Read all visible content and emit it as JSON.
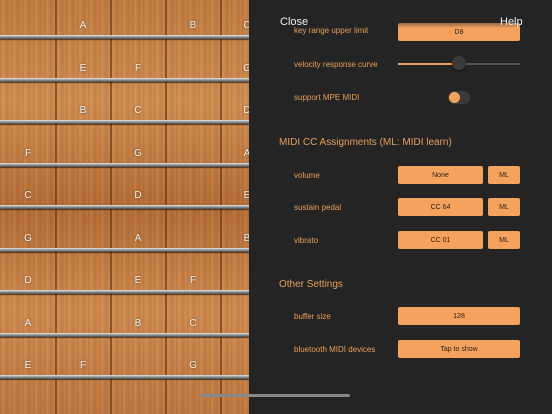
{
  "fretboard": {
    "rows": [
      [
        "",
        "A",
        "",
        "B",
        "C"
      ],
      [
        "",
        "E",
        "F",
        "",
        "G"
      ],
      [
        "",
        "B",
        "C",
        "",
        "D"
      ],
      [
        "F",
        "",
        "G",
        "",
        "A"
      ],
      [
        "C",
        "",
        "D",
        "",
        "E"
      ],
      [
        "G",
        "",
        "A",
        "",
        "B"
      ],
      [
        "D",
        "",
        "E",
        "F",
        ""
      ],
      [
        "A",
        "",
        "B",
        "C",
        ""
      ],
      [
        "E",
        "F",
        "",
        "G",
        ""
      ]
    ]
  },
  "header": {
    "close_label": "Close",
    "help_label": "Help"
  },
  "settings": {
    "key_range_upper_label": "key range upper limit",
    "key_range_upper_value": "D8",
    "velocity_curve_label": "velocity response curve",
    "velocity_curve_level": 0.5,
    "mpe_label": "support MPE MIDI",
    "mpe_enabled": true
  },
  "midi_cc": {
    "title": "MIDI CC Assignments  (ML: MIDI learn)",
    "rows": [
      {
        "label": "volume",
        "value": "None",
        "learn": "ML"
      },
      {
        "label": "sustain pedal",
        "value": "CC 64",
        "learn": "ML"
      },
      {
        "label": "vibrato",
        "value": "CC 01",
        "learn": "ML"
      }
    ]
  },
  "other": {
    "title": "Other Settings",
    "buffer_label": "buffer size",
    "buffer_value": "128",
    "bluetooth_label": "bluetooth MIDI devices",
    "bluetooth_button": "Tap to show"
  },
  "colors": {
    "accent": "#f5a25e",
    "label": "#e79e5c",
    "panel_bg": "#242424"
  }
}
